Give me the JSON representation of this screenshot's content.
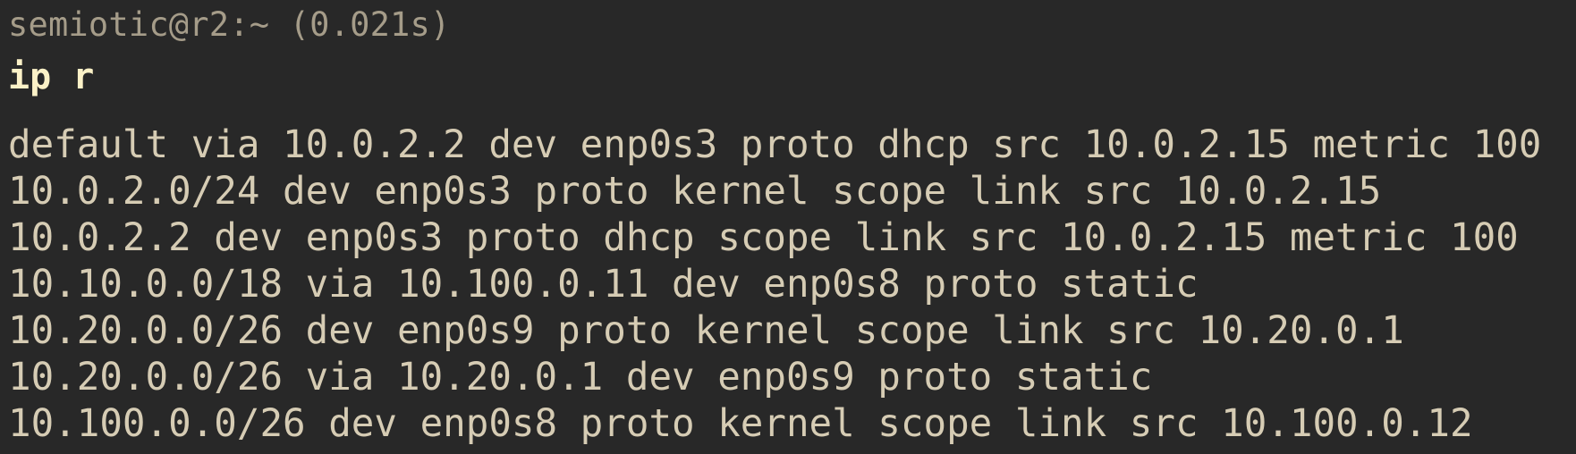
{
  "terminal": {
    "prompt": "semiotic@r2:~ (0.021s)",
    "command": "ip r",
    "output_lines": [
      "default via 10.0.2.2 dev enp0s3 proto dhcp src 10.0.2.15 metric 100",
      "10.0.2.0/24 dev enp0s3 proto kernel scope link src 10.0.2.15",
      "10.0.2.2 dev enp0s3 proto dhcp scope link src 10.0.2.15 metric 100",
      "10.10.0.0/18 via 10.100.0.11 dev enp0s8 proto static",
      "10.20.0.0/26 dev enp0s9 proto kernel scope link src 10.20.0.1",
      "10.20.0.0/26 via 10.20.0.1 dev enp0s9 proto static",
      "10.100.0.0/26 dev enp0s8 proto kernel scope link src 10.100.0.12"
    ]
  },
  "colors": {
    "background": "#282828",
    "prompt_text": "#a59c89",
    "command_text": "#fbf1c7",
    "output_text": "#d6ccb4"
  }
}
